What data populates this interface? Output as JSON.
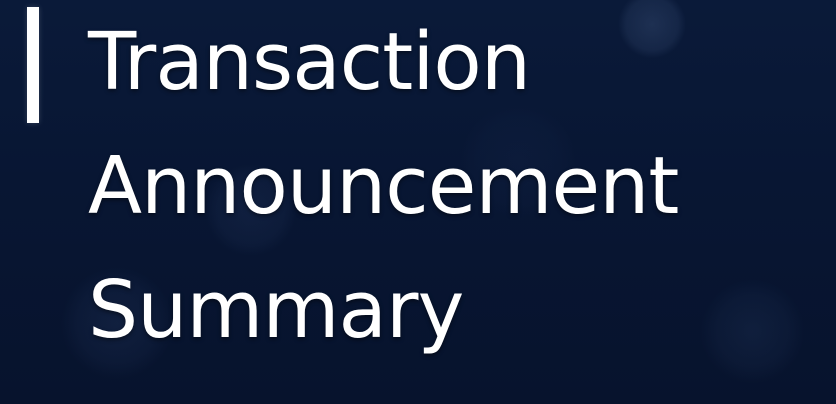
{
  "slide": {
    "title_lines": [
      "Transaction",
      "Announcement",
      "Summary"
    ]
  },
  "colors": {
    "background_primary": "#081633",
    "text": "#ffffff",
    "accent_bar": "#ffffff"
  }
}
